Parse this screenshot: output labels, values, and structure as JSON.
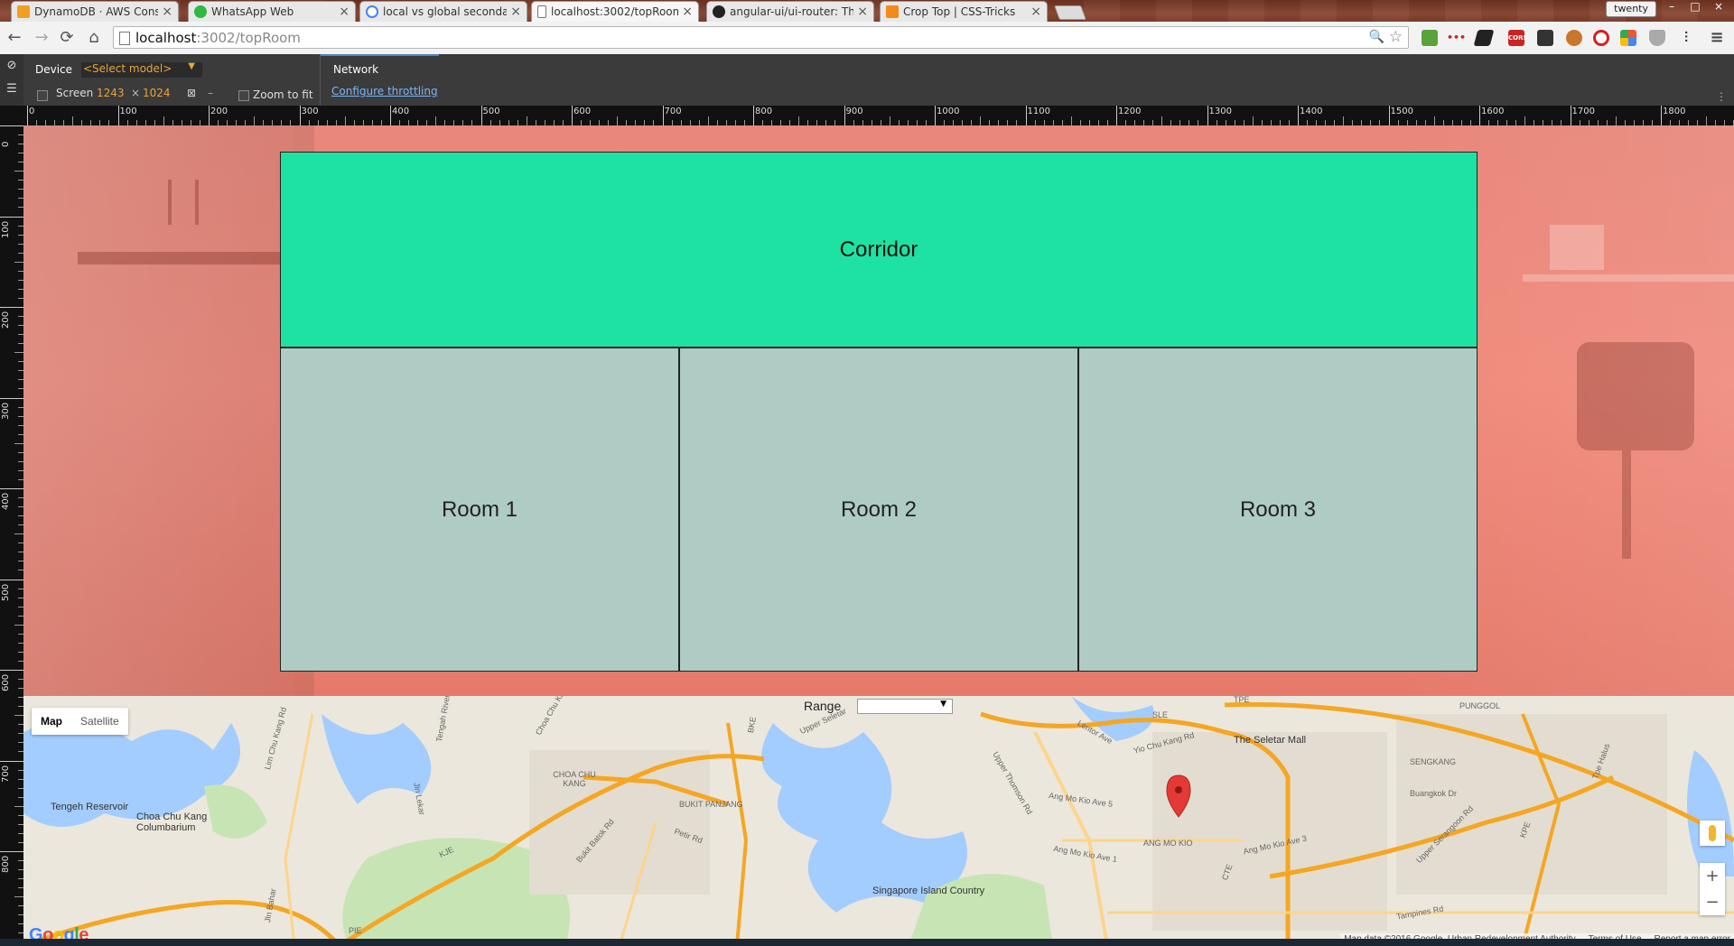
{
  "browser": {
    "tabs": [
      {
        "label": "DynamoDB · AWS Console",
        "favicon_color": "#f0a020",
        "active": false
      },
      {
        "label": "WhatsApp Web",
        "favicon_color": "#2fb844",
        "active": false
      },
      {
        "label": "local vs global secondary i",
        "favicon_color": "#4285f4",
        "active": false
      },
      {
        "label": "localhost:3002/topRoom",
        "favicon_color": "#ffffff",
        "active": true
      },
      {
        "label": "angular-ui/ui-router: The c",
        "favicon_color": "#222222",
        "active": false
      },
      {
        "label": "Crop Top | CSS-Tricks",
        "favicon_color": "#f28a1c",
        "active": false
      }
    ],
    "tab_close": "×",
    "profile_name": "twenty",
    "window_controls": {
      "minimize": "–",
      "maximize": "□",
      "close": "×"
    },
    "address": {
      "host": "localhost",
      "path": ":3002/topRoom"
    },
    "nav": {
      "back": "←",
      "forward": "→",
      "reload": "⟳",
      "home": "⌂"
    },
    "zoom_glyph": "🔍",
    "star_glyph": "☆",
    "menu_glyph": "≡",
    "extensions": [
      {
        "name": "bird-ext-icon",
        "text": "",
        "color": "#5aa23a"
      },
      {
        "name": "dots-ext-icon",
        "text": "•••",
        "color": "#cc2222"
      },
      {
        "name": "boot-ext-icon",
        "text": "",
        "color": "#222222"
      },
      {
        "name": "cors-ext-icon",
        "text": "CORS",
        "color": "#cc2222"
      },
      {
        "name": "pocket-ext-icon",
        "text": "",
        "color": "#333333"
      },
      {
        "name": "cookie-ext-icon",
        "text": "",
        "color": "#c8772b"
      },
      {
        "name": "opera-ext-icon",
        "text": "",
        "color": "#d42020"
      },
      {
        "name": "colors-ext-icon",
        "text": "",
        "color": "#4285f4"
      },
      {
        "name": "shield-ext-icon",
        "text": "",
        "color": "#888888"
      },
      {
        "name": "sliders-ext-icon",
        "text": "",
        "color": "#444444"
      }
    ]
  },
  "devtools": {
    "device_label": "Device",
    "model_placeholder": "<Select model>",
    "screen_label": "Screen",
    "screen_width": "1243",
    "times": "×",
    "screen_height": "1024",
    "dash": "–",
    "zoom_label": "Zoom to fit",
    "network_label": "Network",
    "throttle_link": "Configure throttling",
    "more": "⋮"
  },
  "ruler": {
    "h_ticks": [
      "0",
      "100",
      "200",
      "300",
      "400",
      "500",
      "600",
      "700",
      "800",
      "900",
      "1000",
      "1100",
      "1200",
      "1300",
      "1400",
      "1500",
      "1600",
      "1700",
      "1800"
    ],
    "v_ticks": [
      "0",
      "100",
      "200",
      "300",
      "400",
      "500",
      "600",
      "700",
      "800"
    ]
  },
  "floorplan": {
    "corridor": "Corridor",
    "rooms": [
      "Room 1",
      "Room 2",
      "Room 3"
    ],
    "colors": {
      "corridor": "#1de2a3",
      "room": "#aeccc3",
      "hero_overlay": "#f08a7c"
    }
  },
  "map": {
    "type_map": "Map",
    "type_satellite": "Satellite",
    "range_label": "Range",
    "range_value": "",
    "zoom_in": "+",
    "zoom_out": "−",
    "google": "Google",
    "attribution": "Map data ©2016 Google, Urban Redevelopment Authority",
    "terms": "Terms of Use",
    "report": "Report a map error",
    "labels": [
      "Tengeh Reservoir",
      "Choa Chu Kang Columbarium",
      "Lim Chu Kang Rd",
      "Choa Chu Kang",
      "CHOA CHU KANG",
      "BUKIT PANJANG",
      "Petir Rd",
      "Bukit Batok Rd",
      "Jln Bahar",
      "Upper Seletar",
      "SLE",
      "TPE",
      "PUNGGOL",
      "The Seletar Mall",
      "SENGKANG",
      "Buangkok Dr",
      "Upper Thomson Rd",
      "Ang Mo Kio Ave 5",
      "ANG MO KIO",
      "Ang Mo Kio Ave 3",
      "Upper Serangoon Rd",
      "Singapore Island Country",
      "CTE",
      "KPE",
      "KJE",
      "BKE",
      "PIE",
      "Tampines Rd",
      "Yio Chu Kang Rd",
      "Lentor Ave",
      "Jln Lekar",
      "Tengah River",
      "Ang Mo Kio Ave 1",
      "Tpe Halus"
    ]
  }
}
